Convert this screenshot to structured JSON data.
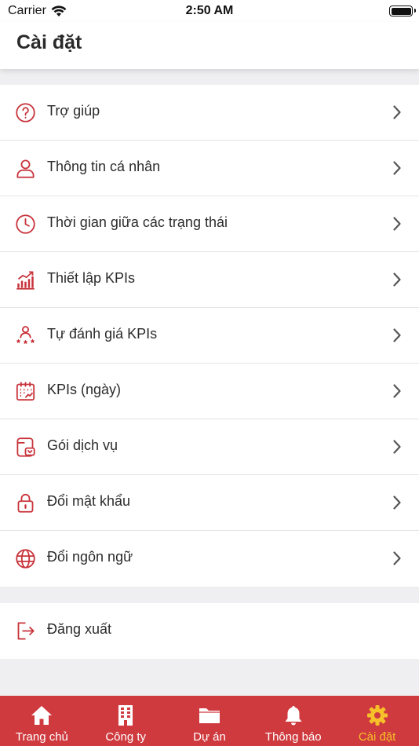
{
  "status_bar": {
    "carrier": "Carrier",
    "time": "2:50 AM"
  },
  "header": {
    "title": "Cài đặt"
  },
  "menu": [
    {
      "label": "Trợ giúp",
      "icon": "help-circle-icon"
    },
    {
      "label": "Thông tin cá nhân",
      "icon": "person-icon"
    },
    {
      "label": "Thời gian giữa các trạng thái",
      "icon": "clock-icon"
    },
    {
      "label": "Thiết lập KPIs",
      "icon": "bar-chart-icon"
    },
    {
      "label": "Tự đánh giá KPIs",
      "icon": "person-stars-icon"
    },
    {
      "label": "KPIs (ngày)",
      "icon": "calendar-icon"
    },
    {
      "label": "Gói dịch vụ",
      "icon": "package-icon"
    },
    {
      "label": "Đổi mật khẩu",
      "icon": "lock-icon"
    },
    {
      "label": "Đổi ngôn ngữ",
      "icon": "globe-icon"
    }
  ],
  "logout": {
    "label": "Đăng xuất",
    "icon": "logout-icon"
  },
  "tabbar": [
    {
      "label": "Trang chủ",
      "icon": "home-icon",
      "active": false
    },
    {
      "label": "Công ty",
      "icon": "building-icon",
      "active": false
    },
    {
      "label": "Dự án",
      "icon": "folder-icon",
      "active": false
    },
    {
      "label": "Thông báo",
      "icon": "bell-icon",
      "active": false
    },
    {
      "label": "Cài đặt",
      "icon": "gear-icon",
      "active": true
    }
  ],
  "colors": {
    "accent": "#cf3a3e",
    "tab_active": "#f6c02a",
    "icon": "#c8323a",
    "background": "#efeff1"
  }
}
